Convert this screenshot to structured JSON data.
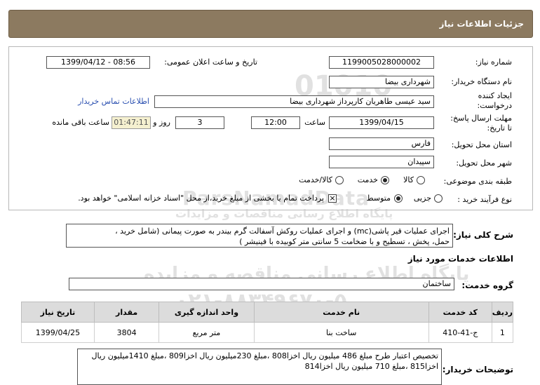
{
  "header": {
    "title": "جزئیات اطلاعات نیاز"
  },
  "watermark": {
    "main": "ParsNamadData",
    "digits": "۰۲۱-۸۸۳۴۹۶۷۰-۵",
    "phone_code": "۰۲۱-۸۸۳۴۹۶۷۰",
    "tagline": "پایگاه اطلاع رسانی مناقصه و مزایده",
    "tagline2": "پایگاه اطلاع رسانی مناقصات و مزایدات"
  },
  "form": {
    "need_number_label": "شماره نیاز:",
    "need_number": "1199005028000002",
    "announce_label": "تاریخ و ساعت اعلان عمومی:",
    "announce_value": "1399/04/12 - 08:56",
    "buyer_org_label": "نام دستگاه خریدار:",
    "buyer_org": "شهرداری بیضا",
    "creator_label_1": "ایجاد کننده",
    "creator_label_2": "درخواست:",
    "creator": "سید عیسی طاهریان کارپرداز شهرداری بیضا",
    "contact_link": "اطلاعات تماس خریدار",
    "deadline_label_1": "مهلت ارسال پاسخ:",
    "deadline_label_2": "تا تاریخ:",
    "deadline_date": "1399/04/15",
    "hour_label": "ساعت",
    "deadline_time": "12:00",
    "days_value": "3",
    "days_label": "روز و",
    "remaining_time": "01:47:11",
    "remaining_label": "ساعت باقی مانده",
    "province_label": "استان محل تحویل:",
    "province": "فارس",
    "city_label": "شهر محل تحویل:",
    "city": "سپیدان",
    "category_label": "طبقه بندی موضوعی:",
    "category_options": [
      "کالا",
      "خدمت",
      "کالا/خدمت"
    ],
    "category_selected": "خدمت",
    "process_label": "نوع فرآیند خرید :",
    "process_options": [
      "جزیی",
      "متوسط"
    ],
    "process_selected": "متوسط",
    "payment_note": "پرداخت تمام یا بخشی از مبلغ خرید،از محل \"اسناد خزانه اسلامی\" خواهد بود."
  },
  "description": {
    "label": "شرح کلی نیاز:",
    "line1": "اجرای عملیات قیر پاشی(mc) و اجرای عملیات روکش آسفالت گرم بیندر به صورت پیمانی (شامل خرید ،",
    "line2": "حمل، پخش ، تسطیح و  با ضخامت 5 سانتی متر کوبیده با فینیشر )"
  },
  "services": {
    "section_title": "اطلاعات خدمات مورد نیاز",
    "group_label": "گروه خدمت:",
    "group_value": "ساختمان",
    "columns": [
      "ردیف",
      "کد خدمت",
      "نام خدمت",
      "واحد اندازه گیری",
      "مقدار",
      "تاریخ نیاز"
    ],
    "rows": [
      {
        "row": "1",
        "code": "ج-41-410",
        "name": "ساخت بنا",
        "unit": "متر مربع",
        "qty": "3804",
        "date": "1399/04/25"
      }
    ]
  },
  "buyer_notes": {
    "label": "توضیحات خریدار:",
    "line1": "تخصیص اعتبار طرح مبلغ 486 میلیون ریال اخزا808 ،مبلغ 230میلیون ریال اخزا809 ،مبلغ 1410میلیون ریال",
    "line2": "اخزا815 ،مبلغ 710 میلیون ریال اخزا814"
  }
}
